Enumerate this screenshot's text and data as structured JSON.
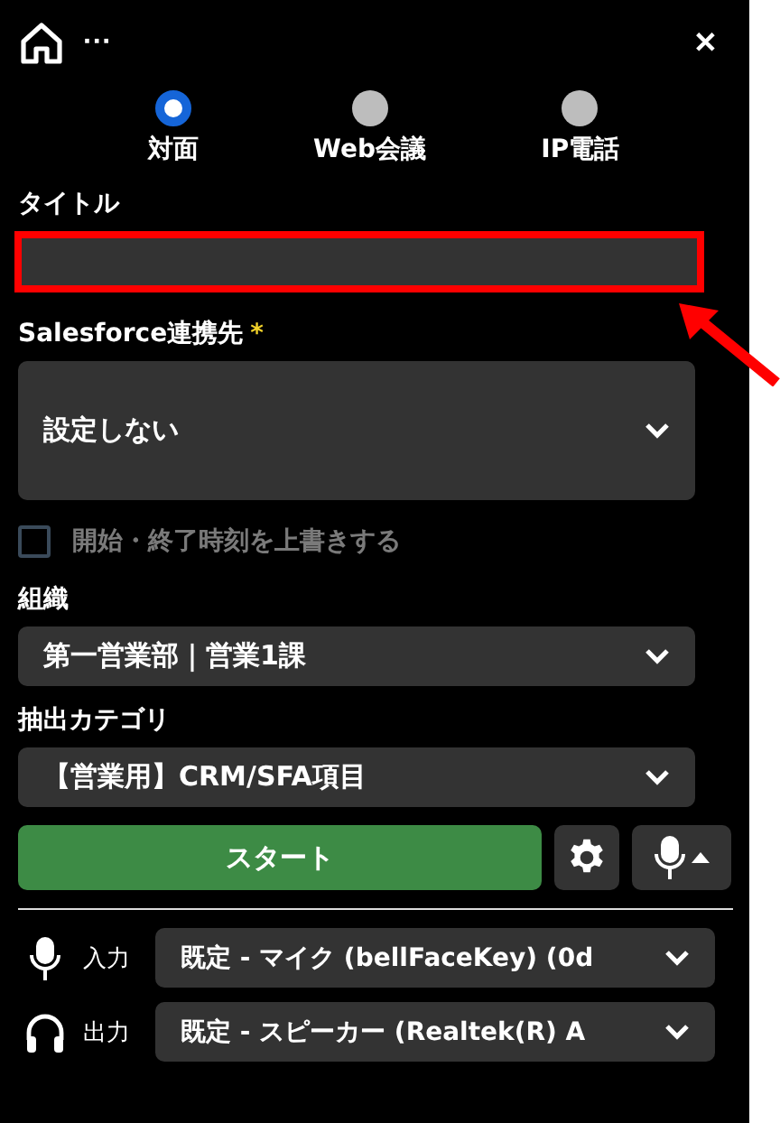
{
  "header": {
    "menu_glyph": "···",
    "close_glyph": "✕"
  },
  "meeting_types": [
    {
      "label": "対面",
      "selected": true
    },
    {
      "label": "Web会議",
      "selected": false
    },
    {
      "label": "IP電話",
      "selected": false
    }
  ],
  "title_field": {
    "label": "タイトル",
    "highlighted": true
  },
  "salesforce": {
    "label": "Salesforce連携先",
    "required_mark": "*",
    "value": "設定しない"
  },
  "override_time": {
    "label": "開始・終了時刻を上書きする",
    "checked": false
  },
  "organization": {
    "label": "組織",
    "value": "第一営業部｜営業1課"
  },
  "category": {
    "label": "抽出カテゴリ",
    "value": "【営業用】CRM/SFA項目"
  },
  "start_button": {
    "label": "スタート"
  },
  "devices": [
    {
      "kind": "mic",
      "label": "入力",
      "value": "既定 - マイク (bellFaceKey) (0d"
    },
    {
      "kind": "headphones",
      "label": "出力",
      "value": "既定 - スピーカー (Realtek(R) A"
    }
  ]
}
